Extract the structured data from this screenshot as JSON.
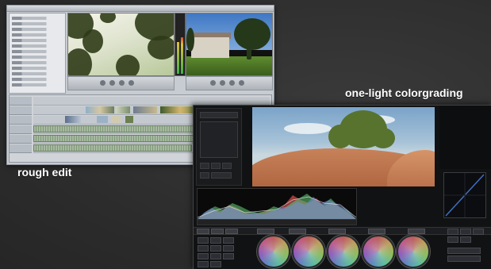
{
  "captions": {
    "rough_edit": "rough edit",
    "one_light": "one-light colorgrading"
  },
  "colors": {
    "background": "#2e2e2e",
    "caption_text": "#ffffff",
    "edit_ui_chrome": "#c7ccd2",
    "grade_ui_background": "#111213"
  },
  "edit_screenshot": {
    "description_icons": [
      "bin-panel",
      "source-monitor",
      "record-monitor",
      "audio-meter",
      "timeline"
    ]
  },
  "grade_screenshot": {
    "description_icons": [
      "viewer",
      "histogram",
      "curve-panel",
      "color-wheel"
    ]
  }
}
